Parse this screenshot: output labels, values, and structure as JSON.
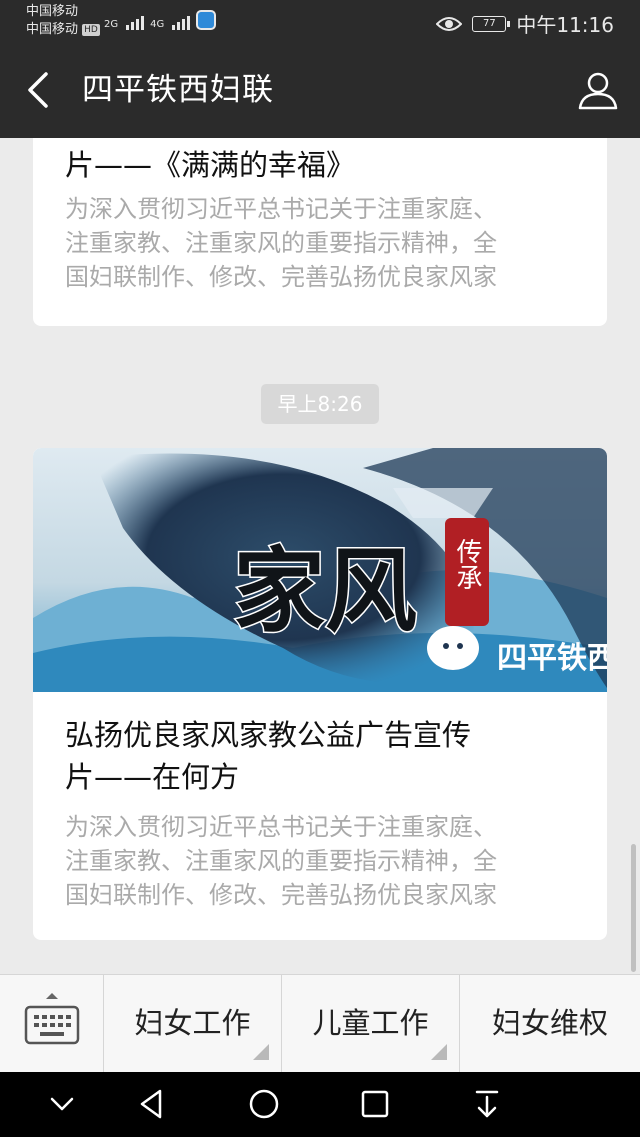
{
  "status_bar": {
    "carrier_1": "中国移动",
    "carrier_2": "中国移动",
    "hd_badge": "HD",
    "network_1": "2G",
    "network_2": "4G",
    "battery": "77",
    "time": "中午11:16"
  },
  "nav": {
    "title": "四平铁西妇联",
    "back_icon": "chevron-left-icon",
    "profile_icon": "person-icon"
  },
  "messages": [
    {
      "title_line": "片——《满满的幸福》",
      "description": [
        "为深入贯彻习近平总书记关于注重家庭、",
        "注重家教、注重家风的重要指示精神，全",
        "国妇联制作、修改、完善弘扬优良家风家"
      ]
    },
    {
      "timestamp": "早上8:26",
      "banner_text": "家风",
      "banner_seal": "传承",
      "banner_caption": "四平铁西",
      "title_lines": [
        "弘扬优良家风家教公益广告宣传",
        "片——在何方"
      ],
      "description": [
        "为深入贯彻习近平总书记关于注重家庭、",
        "注重家教、注重家风的重要指示精神，全",
        "国妇联制作、修改、完善弘扬优良家风家"
      ]
    }
  ],
  "menu": {
    "keyboard_icon": "keyboard-icon",
    "items": [
      "妇女工作",
      "儿童工作",
      "妇女维权"
    ]
  },
  "colors": {
    "header_bg": "#2b2b2b",
    "chat_bg": "#ebebeb",
    "desc_text": "#aaaaaa"
  }
}
